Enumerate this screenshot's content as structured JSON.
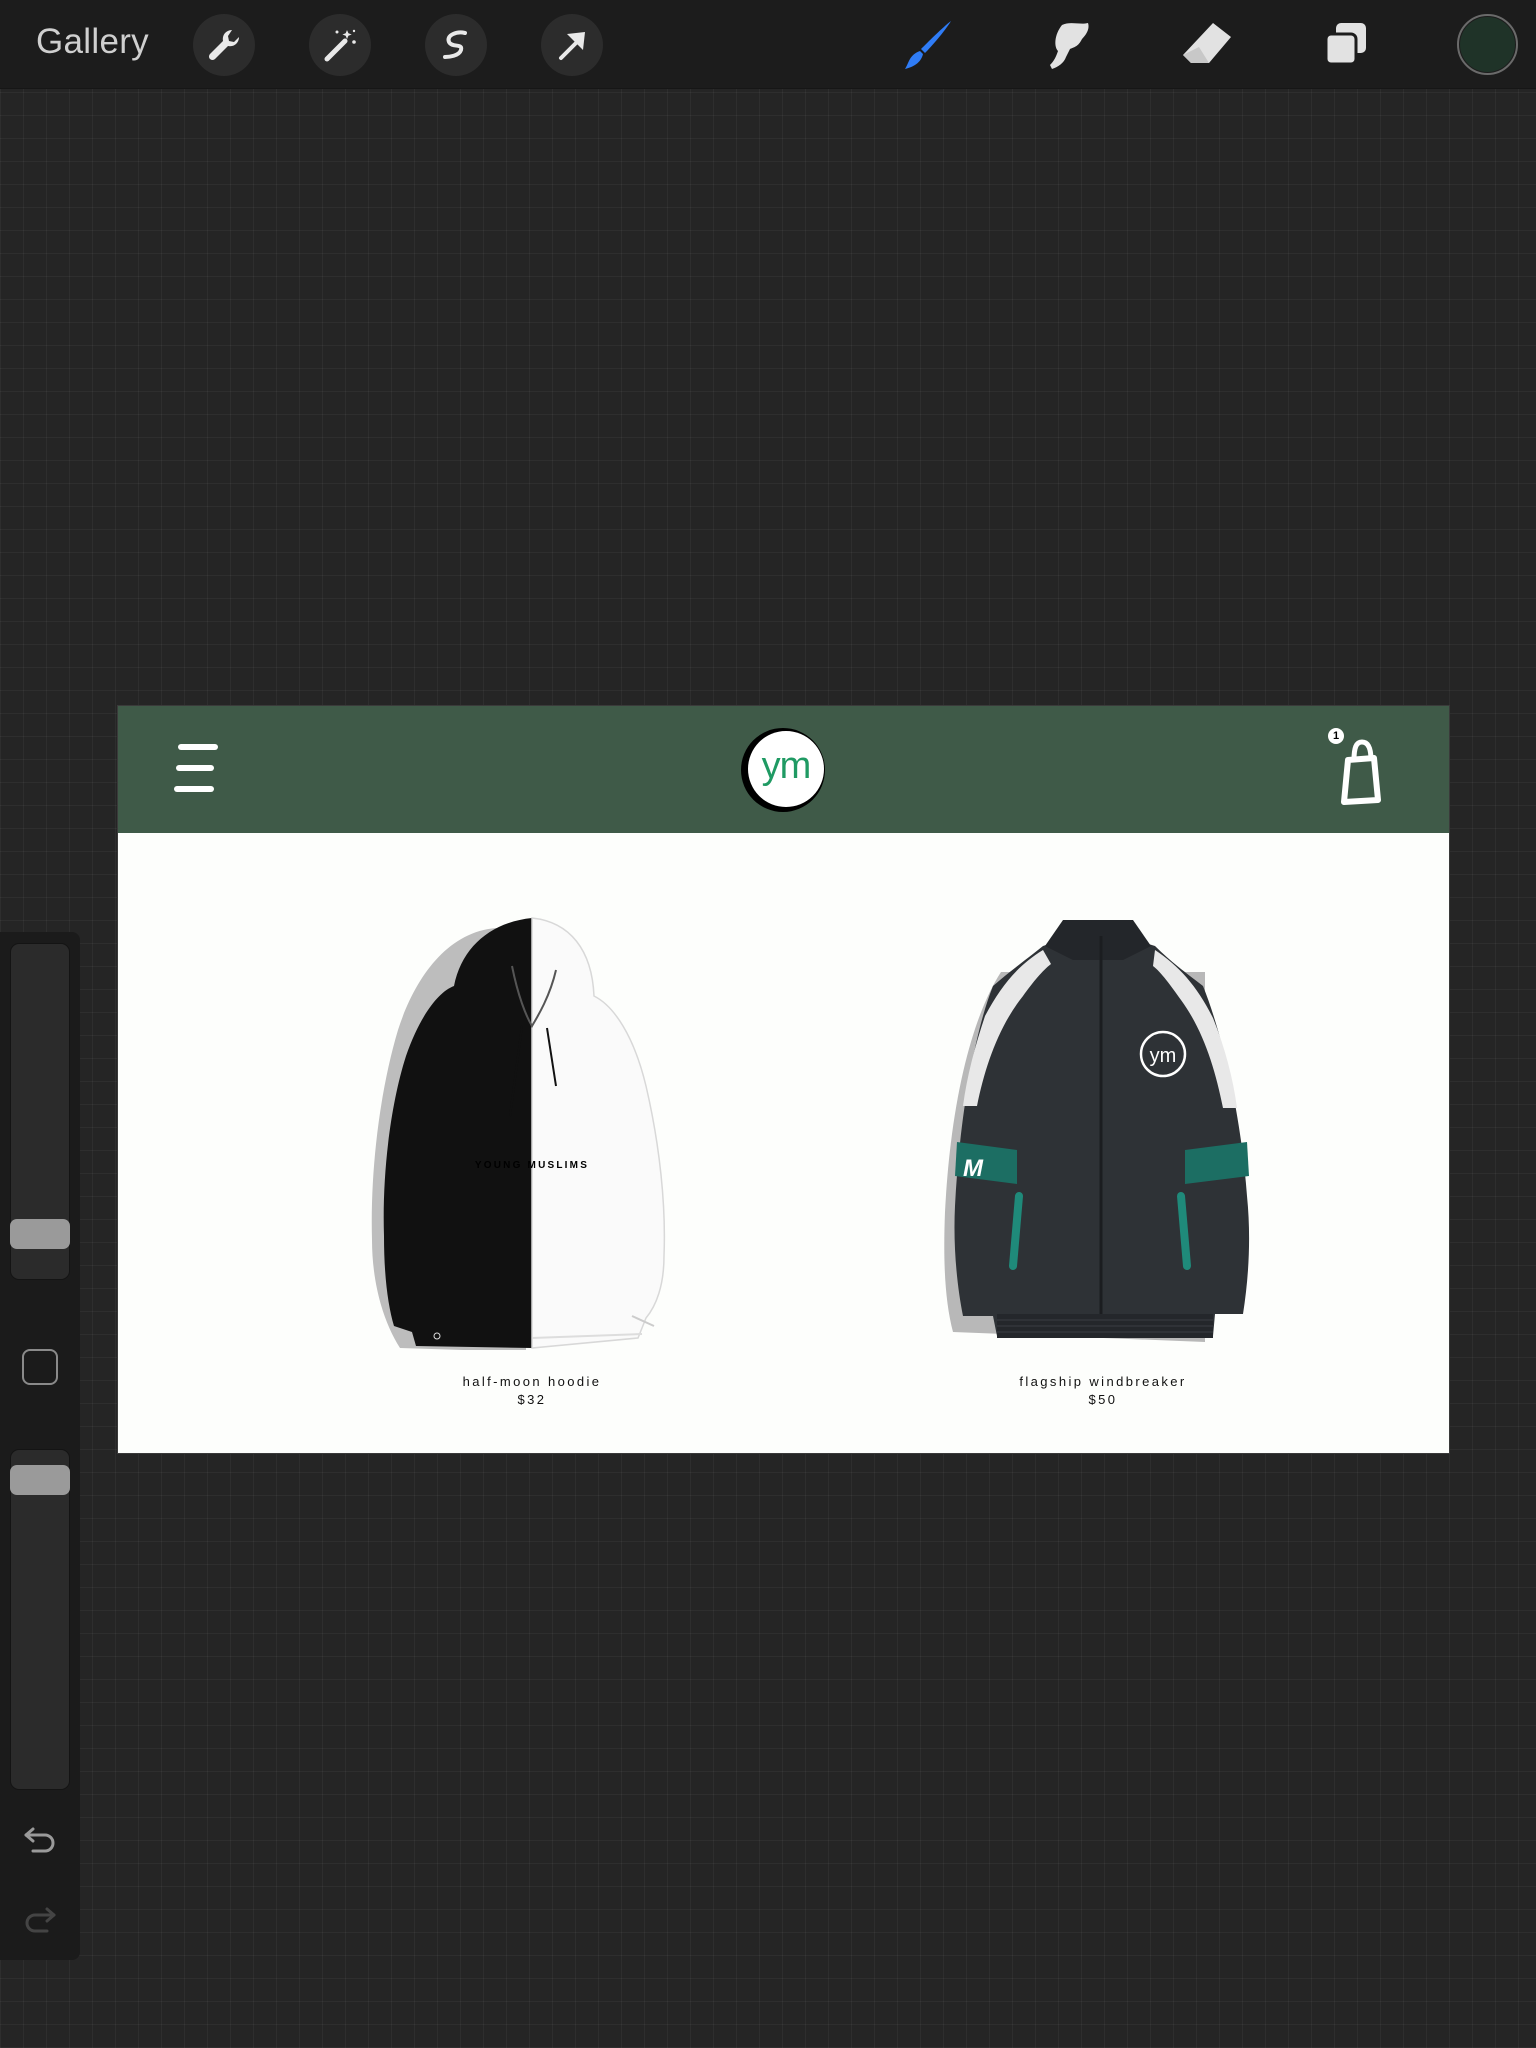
{
  "app": {
    "gallery_label": "Gallery",
    "tools_left": [
      {
        "name": "wrench-icon",
        "label": "Actions"
      },
      {
        "name": "magic-wand-icon",
        "label": "Adjustments"
      },
      {
        "name": "selection-icon",
        "label": "Selection"
      },
      {
        "name": "transform-arrow-icon",
        "label": "Transform"
      }
    ],
    "tools_right": [
      {
        "name": "brush-icon",
        "label": "Paint",
        "active": true
      },
      {
        "name": "smudge-icon",
        "label": "Smudge"
      },
      {
        "name": "eraser-icon",
        "label": "Erase"
      },
      {
        "name": "layers-icon",
        "label": "Layers"
      }
    ],
    "current_color": "#1f3328",
    "accent_color": "#2f7cf6"
  },
  "sidebar": {
    "brush_size_level": 0.1,
    "opacity_level": 0.95,
    "icons": [
      "modify-square-icon",
      "undo-icon",
      "redo-icon"
    ]
  },
  "design": {
    "header_color": "#3f5a48",
    "logo_text": "ym",
    "logo_text_color": "#1f9a63",
    "cart_count": "1",
    "products": [
      {
        "name": "half-moon hoodie",
        "price": "$32",
        "print_text": "YOUNG MUSLIMS"
      },
      {
        "name": "flagship windbreaker",
        "price": "$50",
        "patch_text": "M",
        "badge_text": "ym"
      }
    ]
  }
}
